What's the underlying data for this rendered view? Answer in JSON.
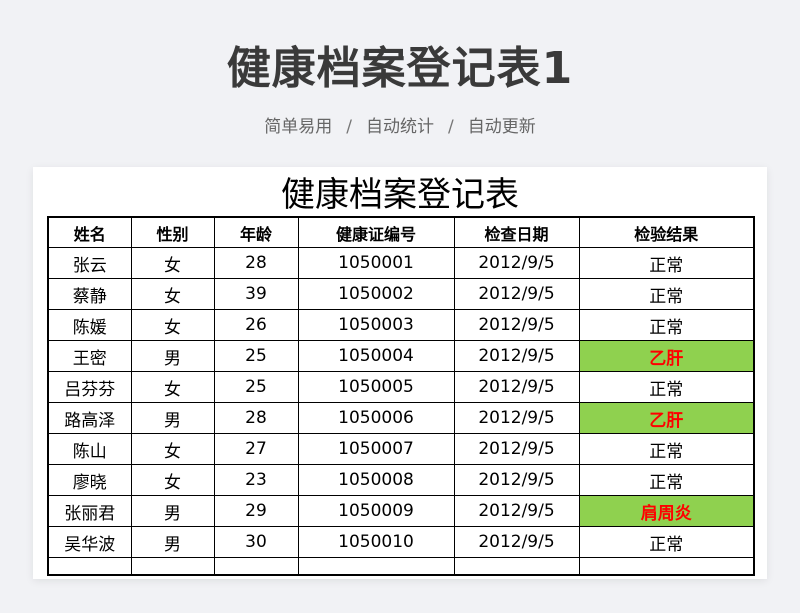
{
  "header": {
    "title": "健康档案登记表1",
    "features": [
      "简单易用",
      "自动统计",
      "自动更新"
    ],
    "separator": "/"
  },
  "sheet": {
    "title": "健康档案登记表",
    "columns": [
      "姓名",
      "性别",
      "年龄",
      "健康证编号",
      "检查日期",
      "检验结果"
    ],
    "rows": [
      {
        "name": "张云",
        "gender": "女",
        "age": "28",
        "cert_no": "1050001",
        "date": "2012/9/5",
        "result": "正常",
        "abnormal": false
      },
      {
        "name": "蔡静",
        "gender": "女",
        "age": "39",
        "cert_no": "1050002",
        "date": "2012/9/5",
        "result": "正常",
        "abnormal": false
      },
      {
        "name": "陈媛",
        "gender": "女",
        "age": "26",
        "cert_no": "1050003",
        "date": "2012/9/5",
        "result": "正常",
        "abnormal": false
      },
      {
        "name": "王密",
        "gender": "男",
        "age": "25",
        "cert_no": "1050004",
        "date": "2012/9/5",
        "result": "乙肝",
        "abnormal": true
      },
      {
        "name": "吕芬芬",
        "gender": "女",
        "age": "25",
        "cert_no": "1050005",
        "date": "2012/9/5",
        "result": "正常",
        "abnormal": false
      },
      {
        "name": "路高泽",
        "gender": "男",
        "age": "28",
        "cert_no": "1050006",
        "date": "2012/9/5",
        "result": "乙肝",
        "abnormal": true
      },
      {
        "name": "陈山",
        "gender": "女",
        "age": "27",
        "cert_no": "1050007",
        "date": "2012/9/5",
        "result": "正常",
        "abnormal": false
      },
      {
        "name": "廖晓",
        "gender": "女",
        "age": "23",
        "cert_no": "1050008",
        "date": "2012/9/5",
        "result": "正常",
        "abnormal": false
      },
      {
        "name": "张丽君",
        "gender": "男",
        "age": "29",
        "cert_no": "1050009",
        "date": "2012/9/5",
        "result": "肩周炎",
        "abnormal": true
      },
      {
        "name": "吴华波",
        "gender": "男",
        "age": "30",
        "cert_no": "1050010",
        "date": "2012/9/5",
        "result": "正常",
        "abnormal": false
      }
    ],
    "colors": {
      "abnormal_fill": "#8fd14f",
      "abnormal_text": "#ff0000"
    }
  }
}
